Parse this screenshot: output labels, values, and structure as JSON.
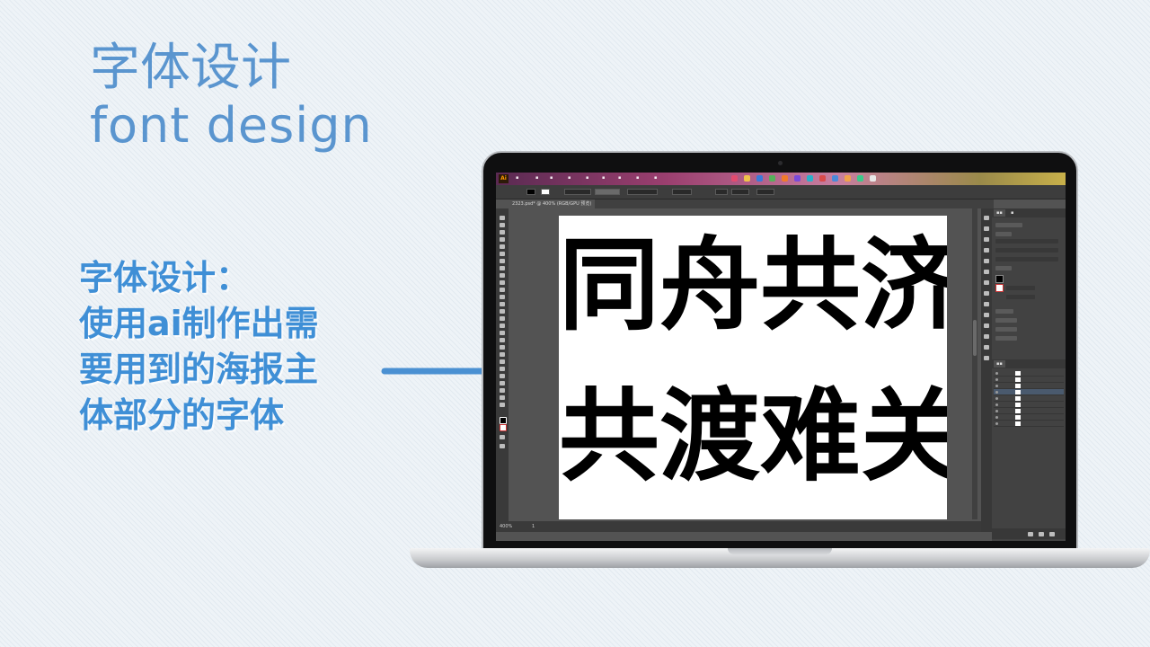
{
  "slide": {
    "title": "字体设计",
    "subtitle": "font design",
    "description_lines": [
      "字体设计：",
      "使用ai制作出需",
      "要用到的海报主",
      "体部分的字体"
    ],
    "accent_color": "#5a95cf",
    "arrow_icon": "right-arrow-icon"
  },
  "app": {
    "logo": "Ai",
    "tab_title": "2323.psd* @ 400% (RGB/GPU 预览)",
    "zoom": "400%",
    "page": "1"
  },
  "artboard": {
    "row1": [
      "同",
      "舟",
      "共",
      "济"
    ],
    "row2": [
      "共",
      "渡",
      "难",
      "关"
    ]
  }
}
